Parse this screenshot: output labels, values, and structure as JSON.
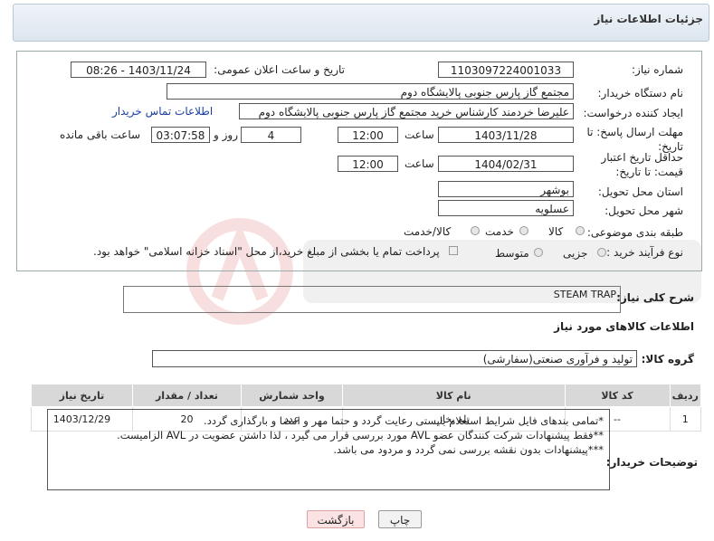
{
  "header": {
    "title": "جزئیات اطلاعات نیاز"
  },
  "form": {
    "need_number_label": "شماره نیاز:",
    "need_number": "1103097224001033",
    "announce_label": "تاریخ و ساعت اعلان عمومی:",
    "announce_value": "1403/11/24 - 08:26",
    "buyer_org_label": "نام دستگاه خریدار:",
    "buyer_org": "مجتمع گاز پارس جنوبی  پالایشگاه دوم",
    "creator_label": "ایجاد کننده درخواست:",
    "creator": "علیرضا خردمند کارشناس خرید مجتمع گاز پارس جنوبی  پالایشگاه دوم",
    "contact_link": "اطلاعات تماس خریدار",
    "deadline_label": "مهلت ارسال پاسخ: تا تاریخ:",
    "deadline_date": "1403/11/28",
    "time_label": "ساعت",
    "deadline_time": "12:00",
    "days_value": "4",
    "days_label": "روز و",
    "remaining_time": "03:07:58",
    "remaining_label": "ساعت باقی مانده",
    "validity_label": "حداقل تاریخ اعتبار قیمت: تا تاریخ:",
    "validity_date": "1404/02/31",
    "validity_time": "12:00",
    "province_label": "استان محل تحویل:",
    "province": "بوشهر",
    "city_label": "شهر محل تحویل:",
    "city": "عسلویه",
    "category_label": "طبقه بندی موضوعی:",
    "category_options": [
      "کالا",
      "خدمت",
      "کالا/خدمت"
    ],
    "process_label": "نوع فرآیند خرید :",
    "process_options": [
      "جزیی",
      "متوسط"
    ],
    "payment_note": "پرداخت تمام یا بخشی از مبلغ خرید،از محل \"اسناد خزانه اسلامی\" خواهد بود."
  },
  "summary": {
    "label": "شرح کلی نیاز:",
    "value": "STEAM TRAP"
  },
  "goods_section_title": "اطلاعات کالاهای مورد نیاز",
  "goods_group": {
    "label": "گروه کالا:",
    "value": "تولید و فرآوری صنعتی(سفارشی)"
  },
  "table": {
    "headers": [
      "ردیف",
      "کد کالا",
      "نام کالا",
      "واحد شمارش",
      "تعداد / مقدار",
      "تاریخ نیاز"
    ],
    "rows": [
      [
        "1",
        "--",
        "تله بخار",
        "عدد",
        "20",
        "1403/12/29"
      ]
    ]
  },
  "buyer_notes": {
    "label": "توضیحات خریدار:",
    "lines": [
      "*تمامی بندهای فایل شرایط استعلام بایستی رعایت گردد و حتما مهر و امضا و بارگذاری گردد.",
      "**فقط پیشنهادات شرکت کنندگان عضو AVL مورد بررسی قرار می گیرد ، لذا داشتن عضویت در AVL الزامیست.",
      "***پیشنهادات بدون نقشه بررسی نمی گردد و مردود می باشد."
    ]
  },
  "buttons": {
    "print": "چاپ",
    "back": "بازگشت"
  }
}
